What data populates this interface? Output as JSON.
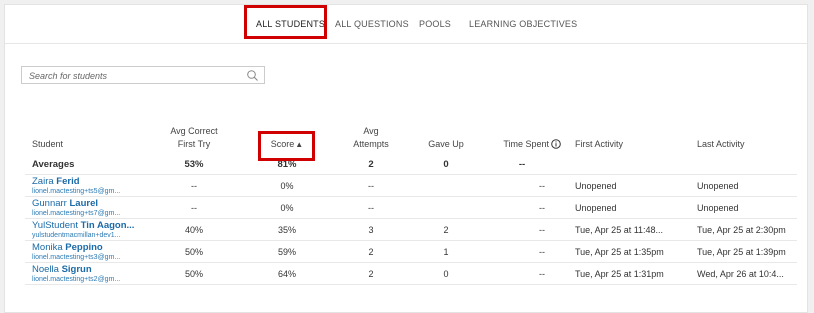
{
  "tabs": [
    {
      "label": "ALL STUDENTS",
      "active": true
    },
    {
      "label": "ALL QUESTIONS",
      "active": false
    },
    {
      "label": "POOLS",
      "active": false
    },
    {
      "label": "LEARNING OBJECTIVES",
      "active": false
    }
  ],
  "search": {
    "placeholder": "Search for students",
    "icon": "search-icon"
  },
  "columns": {
    "student": "Student",
    "avg_correct_line1": "Avg Correct",
    "avg_correct_line2": "First Try",
    "score": "Score",
    "avg_attempts_line1": "Avg",
    "avg_attempts_line2": "Attempts",
    "gave_up": "Gave Up",
    "time_spent": "Time Spent",
    "first_activity": "First Activity",
    "last_activity": "Last Activity"
  },
  "averages": {
    "label": "Averages",
    "avg_correct": "53%",
    "score": "81%",
    "attempts": "2",
    "gave_up": "0",
    "time_spent": "--"
  },
  "rows": [
    {
      "first": "Zaira",
      "last": "Ferid",
      "email": "lionel.mactesting+ts5@gm...",
      "avg_correct": "--",
      "score": "0%",
      "attempts": "--",
      "gave_up": "",
      "time_spent": "--",
      "first_activity": "Unopened",
      "last_activity": "Unopened"
    },
    {
      "first": "Gunnarr",
      "last": "Laurel",
      "email": "lionel.mactesting+ts7@gm...",
      "avg_correct": "--",
      "score": "0%",
      "attempts": "--",
      "gave_up": "",
      "time_spent": "--",
      "first_activity": "Unopened",
      "last_activity": "Unopened"
    },
    {
      "first": "YulStudent",
      "last": "Tin Aagon...",
      "email": "yulstudentmacmillan+dev1...",
      "avg_correct": "40%",
      "score": "35%",
      "attempts": "3",
      "gave_up": "2",
      "time_spent": "--",
      "first_activity": "Tue, Apr 25 at 11:48...",
      "last_activity": "Tue, Apr 25 at 2:30pm"
    },
    {
      "first": "Monika",
      "last": "Peppino",
      "email": "lionel.mactesting+ts3@gm...",
      "avg_correct": "50%",
      "score": "59%",
      "attempts": "2",
      "gave_up": "1",
      "time_spent": "--",
      "first_activity": "Tue, Apr 25 at 1:35pm",
      "last_activity": "Tue, Apr 25 at 1:39pm"
    },
    {
      "first": "Noella",
      "last": "Sigrun",
      "email": "lionel.mactesting+ts2@gm...",
      "avg_correct": "50%",
      "score": "64%",
      "attempts": "2",
      "gave_up": "0",
      "time_spent": "--",
      "first_activity": "Tue, Apr 25 at 1:31pm",
      "last_activity": "Wed, Apr 26 at 10:4..."
    }
  ],
  "colors": {
    "highlight": "#d00000",
    "link": "#1a6aa8"
  }
}
